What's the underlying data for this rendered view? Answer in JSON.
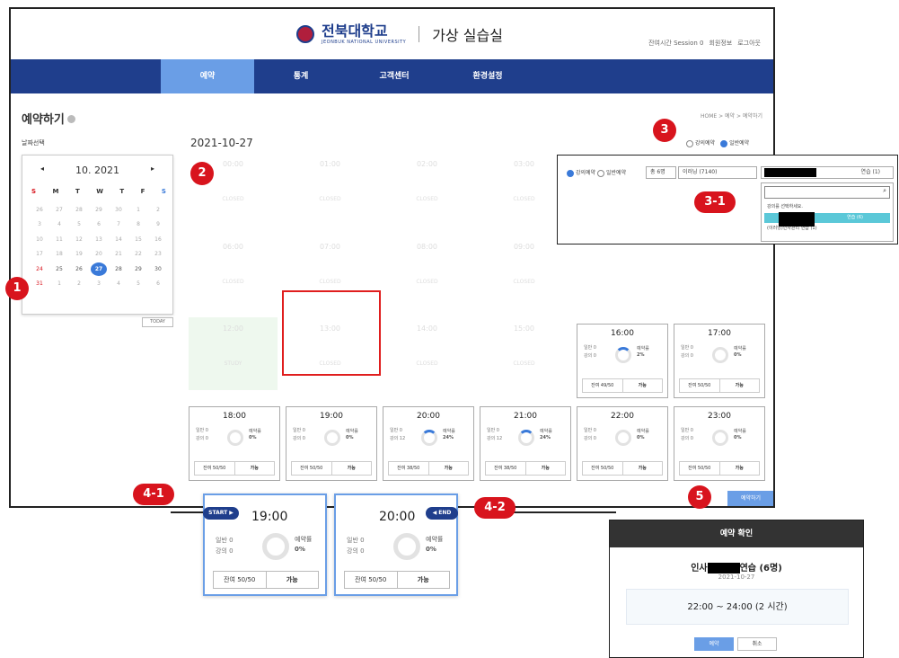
{
  "header": {
    "univ_name": "전북대학교",
    "univ_sub": "JEONBUK NATIONAL UNIVERSITY",
    "system_name": "가상 실습실",
    "util": [
      "잔여시간 Session 0",
      "회원정보",
      "로그아웃"
    ]
  },
  "nav": [
    "예약",
    "통계",
    "고객센터",
    "환경설정"
  ],
  "page": {
    "title": "예약하기",
    "breadcrumb": "HOME > 예약 > 예약하기"
  },
  "calendar": {
    "label": "날짜선택",
    "month": "10. 2021",
    "prev": "◂",
    "next": "▸",
    "weekdays": [
      "S",
      "M",
      "T",
      "W",
      "T",
      "F",
      "S"
    ],
    "weeks": [
      [
        "26",
        "27",
        "28",
        "29",
        "30",
        "1",
        "2"
      ],
      [
        "3",
        "4",
        "5",
        "6",
        "7",
        "8",
        "9"
      ],
      [
        "10",
        "11",
        "12",
        "13",
        "14",
        "15",
        "16"
      ],
      [
        "17",
        "18",
        "19",
        "20",
        "21",
        "22",
        "23"
      ],
      [
        "24",
        "25",
        "26",
        "27",
        "28",
        "29",
        "30"
      ],
      [
        "31",
        "1",
        "2",
        "3",
        "4",
        "5",
        "6"
      ]
    ],
    "today_button": "TODAY"
  },
  "selected_date": "2021-10-27",
  "mode": {
    "option1": "강의예약",
    "option2": "일반예약"
  },
  "closed_slots": [
    {
      "time": "00:00",
      "status": "CLOSED"
    },
    {
      "time": "01:00",
      "status": "CLOSED"
    },
    {
      "time": "02:00",
      "status": "CLOSED"
    },
    {
      "time": "03:00",
      "status": "CLOSED"
    },
    {
      "time": "06:00",
      "status": "CLOSED"
    },
    {
      "time": "07:00",
      "status": "CLOSED"
    },
    {
      "time": "08:00",
      "status": "CLOSED"
    },
    {
      "time": "09:00",
      "status": "CLOSED"
    },
    {
      "time": "12:00",
      "status": "STUDY"
    },
    {
      "time": "13:00",
      "status": "CLOSED"
    },
    {
      "time": "14:00",
      "status": "CLOSED"
    },
    {
      "time": "15:00",
      "status": "CLOSED"
    }
  ],
  "cards": [
    {
      "time": "16:00",
      "l1": "일반 0",
      "l2": "강의 0",
      "label": "예약률",
      "pct": "2%",
      "remain": "잔여 49/50",
      "btn": "가능"
    },
    {
      "time": "17:00",
      "l1": "일반 0",
      "l2": "강의 0",
      "label": "예약률",
      "pct": "0%",
      "remain": "잔여 50/50",
      "btn": "가능"
    },
    {
      "time": "18:00",
      "l1": "일반 0",
      "l2": "강의 0",
      "label": "예약률",
      "pct": "0%",
      "remain": "잔여 50/50",
      "btn": "가능"
    },
    {
      "time": "19:00",
      "l1": "일반 0",
      "l2": "강의 0",
      "label": "예약률",
      "pct": "0%",
      "remain": "잔여 50/50",
      "btn": "가능"
    },
    {
      "time": "20:00",
      "l1": "일반 0",
      "l2": "강의 12",
      "label": "예약률",
      "pct": "24%",
      "remain": "잔여 38/50",
      "btn": "가능"
    },
    {
      "time": "21:00",
      "l1": "일반 0",
      "l2": "강의 12",
      "label": "예약률",
      "pct": "24%",
      "remain": "잔여 38/50",
      "btn": "가능"
    },
    {
      "time": "22:00",
      "l1": "일반 0",
      "l2": "강의 0",
      "label": "예약률",
      "pct": "0%",
      "remain": "잔여 50/50",
      "btn": "가능"
    },
    {
      "time": "23:00",
      "l1": "일반 0",
      "l2": "강의 0",
      "label": "예약률",
      "pct": "0%",
      "remain": "잔여 50/50",
      "btn": "가능"
    }
  ],
  "reserve_button": "예약하기",
  "markers": {
    "m1": "1",
    "m2": "2",
    "m3": "3",
    "m31": "3-1",
    "m41": "4-1",
    "m42": "4-2",
    "m5": "5"
  },
  "popup31": {
    "r1": "강의예약",
    "r2": "일반예약",
    "count": "총 6명",
    "room": "이러닝 (7140)",
    "course": "연습 (1)",
    "search_icon": "⌕",
    "opt1": "강의를 선택하세요.",
    "opt2": "연습 (6)",
    "opt3": "(이러닝)인사관리 연습 (1)"
  },
  "start_card": {
    "tag": "START ▶",
    "time": "19:00",
    "l1": "일반 0",
    "l2": "강의 0",
    "label": "예약률",
    "pct": "0%",
    "remain": "잔여 50/50",
    "btn": "가능"
  },
  "end_card": {
    "tag": "◀ END",
    "time": "20:00",
    "l1": "일반 0",
    "l2": "강의 0",
    "label": "예약률",
    "pct": "0%",
    "remain": "잔여 50/50",
    "btn": "가능"
  },
  "modal": {
    "header": "예약 확인",
    "title_a": "인사",
    "title_b": "연습 (6명)",
    "date": "2021-10-27",
    "range": "22:00 ~ 24:00 (2 시간)",
    "ok": "예약",
    "cancel": "취소"
  }
}
